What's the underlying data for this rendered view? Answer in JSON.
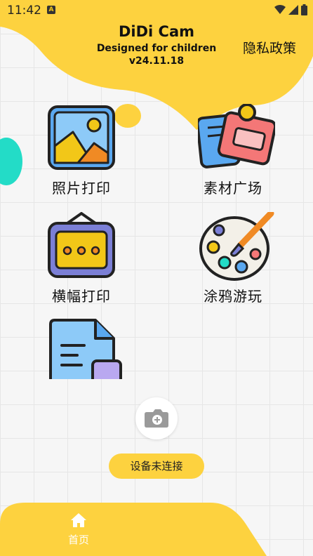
{
  "status_bar": {
    "time": "11:42",
    "notif_glyph": "A"
  },
  "header": {
    "title": "DiDi Cam",
    "subtitle": "Designed for children",
    "version": "v24.11.18",
    "privacy_label": "隐私政策"
  },
  "tiles": [
    {
      "label": "照片打印",
      "icon": "photo-icon"
    },
    {
      "label": "素材广场",
      "icon": "material-icon"
    },
    {
      "label": "横幅打印",
      "icon": "banner-icon"
    },
    {
      "label": "涂鸦游玩",
      "icon": "palette-icon"
    },
    {
      "label": "",
      "icon": "document-icon"
    }
  ],
  "device": {
    "status": "设备未连接"
  },
  "bottom_nav": {
    "home_label": "首页"
  },
  "colors": {
    "brand_yellow": "#fdd23f",
    "accent_aqua": "#23dcc7"
  }
}
